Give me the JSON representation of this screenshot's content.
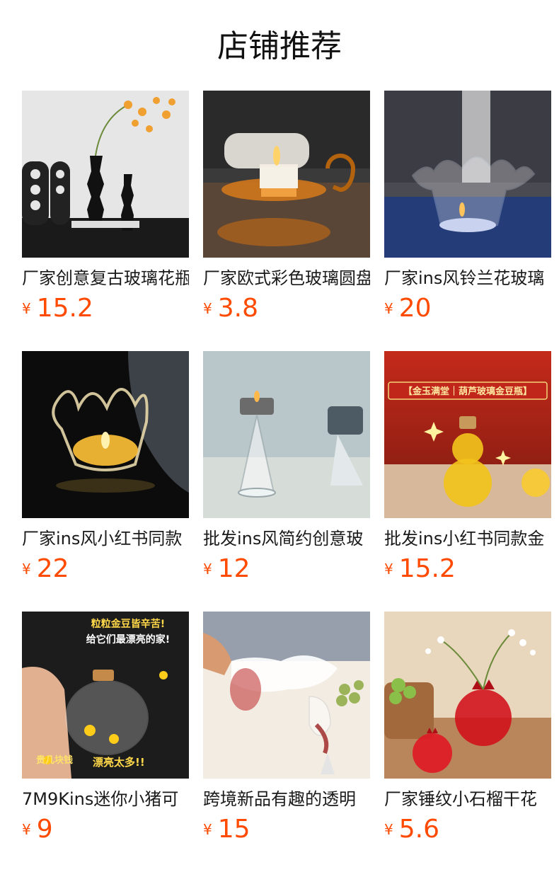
{
  "page": {
    "title": "店铺推荐"
  },
  "products": [
    {
      "name": "厂家创意复古玻璃花瓶",
      "currency": "¥",
      "price": "15.2",
      "image_icon": "black-vase-flowers-photo"
    },
    {
      "name": "厂家欧式彩色玻璃圆盘",
      "currency": "¥",
      "price": "3.8",
      "image_icon": "amber-candle-holder-photo"
    },
    {
      "name": "厂家ins风铃兰花玻璃",
      "currency": "¥",
      "price": "20",
      "image_icon": "lily-glass-candle-holder-photo"
    },
    {
      "name": "厂家ins风小红书同款",
      "currency": "¥",
      "price": "22",
      "image_icon": "crown-glass-candle-photo"
    },
    {
      "name": "批发ins风简约创意玻",
      "currency": "¥",
      "price": "12",
      "image_icon": "cone-glass-candle-photo"
    },
    {
      "name": "批发ins小红书同款金",
      "currency": "¥",
      "price": "15.2",
      "image_icon": "gourd-gold-bean-bottle-photo",
      "image_banner": "【金玉满堂｜葫芦玻璃金豆瓶】"
    },
    {
      "name": "7M9Kins迷你小猪可",
      "currency": "¥",
      "price": "9",
      "image_icon": "piggy-glass-jar-photo",
      "image_text": [
        "粒粒金豆皆辛苦!",
        "给它们最漂亮的家!",
        "贵几块钱",
        "漂亮太多!!"
      ]
    },
    {
      "name": "跨境新品有趣的透明",
      "currency": "¥",
      "price": "15",
      "image_icon": "smoke-wine-glass-photo"
    },
    {
      "name": "厂家锤纹小石榴干花",
      "currency": "¥",
      "price": "5.6",
      "image_icon": "red-pomegranate-vase-photo"
    }
  ]
}
